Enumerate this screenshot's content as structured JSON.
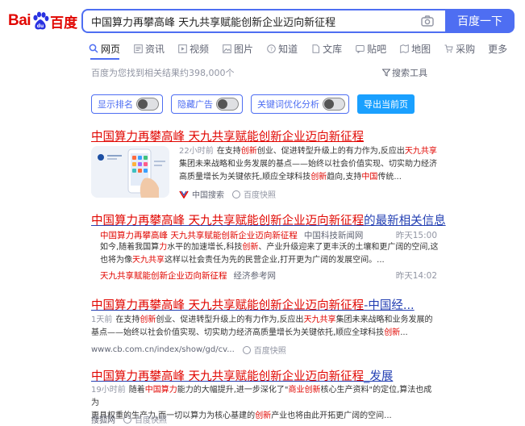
{
  "header": {
    "logo_bai": "Bai",
    "logo_du": "百度",
    "search_value": "中国算力再攀高峰 天九共享赋能创新企业迈向新征程",
    "search_button": "百度一下"
  },
  "tabs": [
    {
      "label": "网页",
      "icon": "search-icon"
    },
    {
      "label": "资讯",
      "icon": "news-icon"
    },
    {
      "label": "视频",
      "icon": "video-icon"
    },
    {
      "label": "图片",
      "icon": "image-icon"
    },
    {
      "label": "知道",
      "icon": "zhidao-icon"
    },
    {
      "label": "文库",
      "icon": "wenku-icon"
    },
    {
      "label": "贴吧",
      "icon": "tieba-icon"
    },
    {
      "label": "地图",
      "icon": "map-icon"
    },
    {
      "label": "采购",
      "icon": "cart-icon"
    },
    {
      "label": "更多",
      "icon": ""
    }
  ],
  "result_count": "百度为您找到相关结果约398,000个",
  "search_tools": "搜索工具",
  "plugins": {
    "show_rank": "显示排名",
    "hide_ads": "隐藏广告",
    "keyword_analysis": "关键词优化分析",
    "export": "导出当前页"
  },
  "results": [
    {
      "title": "中国算力再攀高峰 天九共享赋能创新企业迈向新征程",
      "time": "22小时前",
      "snippet_1a": "在支持",
      "snippet_1b": "创新",
      "snippet_1c": "创业、促进转型升级上的有力作为,反应出",
      "snippet_1d": "天九共享",
      "snippet_2": "集团未来战略和业务发展的基点——始终以社会价值实现、切实助力经济",
      "snippet_3a": "高质量增长为关键依托,顺应全球科技",
      "snippet_3b": "创新",
      "snippet_3c": "趋向,支持",
      "snippet_3d": "中国",
      "snippet_3e": "传统...",
      "source": "中国搜索",
      "snapshot": "百度快照"
    },
    {
      "title_red": "中国算力再攀高峰 天九共享赋能创新企业迈向新征程",
      "title_blue": "的最新相关信息",
      "sub1_title": "中国算力再攀高峰 天九共享赋能创新企业迈向新征程",
      "sub1_src": "中国科技新闻网",
      "sub1_time": "昨天15:00",
      "snippet_1a": "如今,随着我国算",
      "snippet_1b": "力",
      "snippet_1c": "水平的加速增长,科技",
      "snippet_1d": "创新",
      "snippet_1e": "、产业升级迎来了更丰沃的土壤和更广阔的空间,这",
      "snippet_2a": "也将为像",
      "snippet_2b": "天九共享",
      "snippet_2c": "这样以社会责任为先的民营企业,打开更为广阔的发展空间。...",
      "sub2_title": "天九共享赋能创新企业迈向新征程",
      "sub2_src": "经济参考网",
      "sub2_time": "昨天14:02"
    },
    {
      "title_red": "中国算力再攀高峰 天九共享赋能创新企业迈向新征程",
      "title_blue": "-中国经...",
      "time": "1天前",
      "snippet_1a": "在支持",
      "snippet_1b": "创新",
      "snippet_1c": "创业、促进转型升级上的有力作为,反应出",
      "snippet_1d": "天九共享",
      "snippet_1e": "集团未来战略和业务发展的",
      "snippet_2a": "基点——始终以社会价值实现、切实助力经济高质量增长为关键依托,顺应全球科技",
      "snippet_2b": "创新",
      "snippet_2c": "...",
      "url": "www.cb.com.cn/index/show/gd/cv...",
      "snapshot": "百度快照"
    },
    {
      "title_red": "中国算力再攀高峰 天九共享赋能创新企业迈向新征程",
      "title_blue": "_发展",
      "time": "19小时前",
      "snippet_1a": "随着",
      "snippet_1b": "中国算力",
      "snippet_1c": "能力的大幅提升,进一步深化了\"",
      "snippet_1d": "商业创新",
      "snippet_1e": "核心生产资料\"的定位,算法也成为",
      "snippet_2a": "更具权重的生产力,而一切以算力为核心基建的",
      "snippet_2b": "创新",
      "snippet_2c": "产业也将由此开拓更广阔的空间...",
      "source": "搜狐网",
      "snapshot": "百度快照"
    }
  ],
  "colors": {
    "accent": "#4e6ef2",
    "link": "#2440b3",
    "highlight": "#e10601"
  }
}
